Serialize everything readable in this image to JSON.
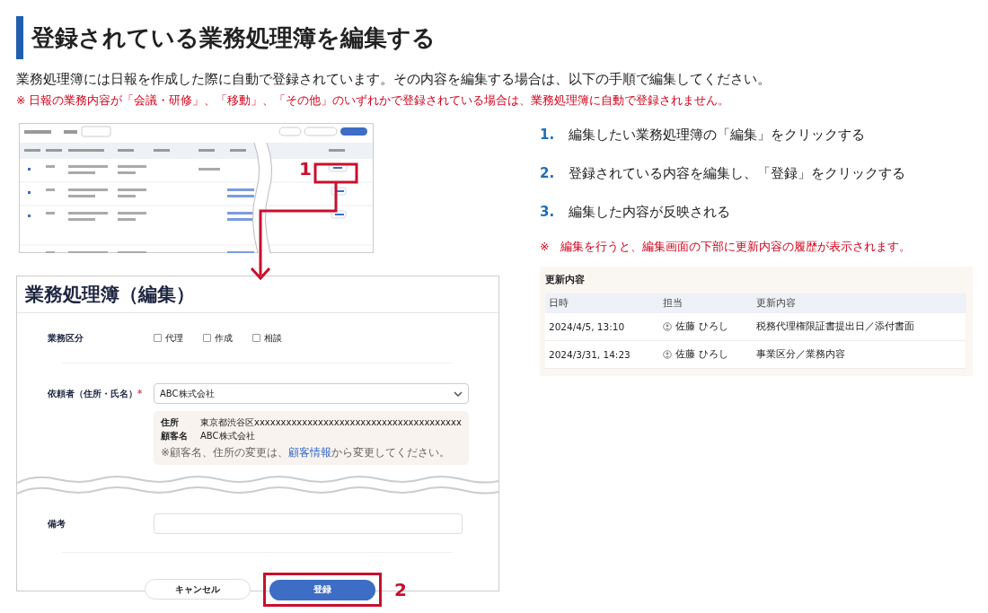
{
  "heading": "登録されている業務処理簿を編集する",
  "intro": "業務処理簿には日報を作成した際に自動で登録されています。その内容を編集する場合は、以下の手順で編集してください。",
  "note": "※ 日報の業務内容が「会議・研修」、「移動」、「その他」のいずれかで登録されている場合は、業務処理簿に自動で登録されません。",
  "list_preview": {
    "callout": "1"
  },
  "edit_form": {
    "title": "業務処理簿（編集）",
    "category": {
      "label": "業務区分",
      "options": [
        {
          "label": "代理",
          "checked": false
        },
        {
          "label": "作成",
          "checked": false
        },
        {
          "label": "相談",
          "checked": false
        }
      ]
    },
    "client": {
      "label": "依頼者（住所・氏名）",
      "required_mark": "*",
      "value": "ABC株式会社",
      "details": [
        {
          "label": "住所",
          "value": "東京都渋谷区xxxxxxxxxxxxxxxxxxxxxxxxxxxxxxxxxxxxxxx"
        },
        {
          "label": "顧客名",
          "value": "ABC株式会社"
        }
      ],
      "hint_before": "※顧客名、住所の変更は、",
      "hint_link": "顧客情報",
      "hint_after": "から変更してください。"
    },
    "remarks": {
      "label": "備考"
    },
    "buttons": [
      {
        "label": "キャンセル",
        "kind": "secondary"
      },
      {
        "label": "登録",
        "kind": "primary",
        "highlighted": true
      }
    ],
    "callout": "2"
  },
  "steps": [
    {
      "number": "1.",
      "text": "編集したい業務処理簿の「編集」をクリックする"
    },
    {
      "number": "2.",
      "text": "登録されている内容を編集し、「登録」をクリックする"
    },
    {
      "number": "3.",
      "text": "編集した内容が反映される"
    }
  ],
  "steps_note": "※　編集を行うと、編集画面の下部に更新内容の履歴が表示されます。",
  "history": {
    "title": "更新内容",
    "columns": [
      "日時",
      "担当",
      "更新内容"
    ],
    "rows": [
      {
        "date": "2024/4/5, 13:10",
        "user": "佐藤 ひろし",
        "change": "税務代理権限証書提出日／添付書面"
      },
      {
        "date": "2024/3/31, 14:23",
        "user": "佐藤 ひろし",
        "change": "事業区分／業務内容"
      }
    ]
  }
}
